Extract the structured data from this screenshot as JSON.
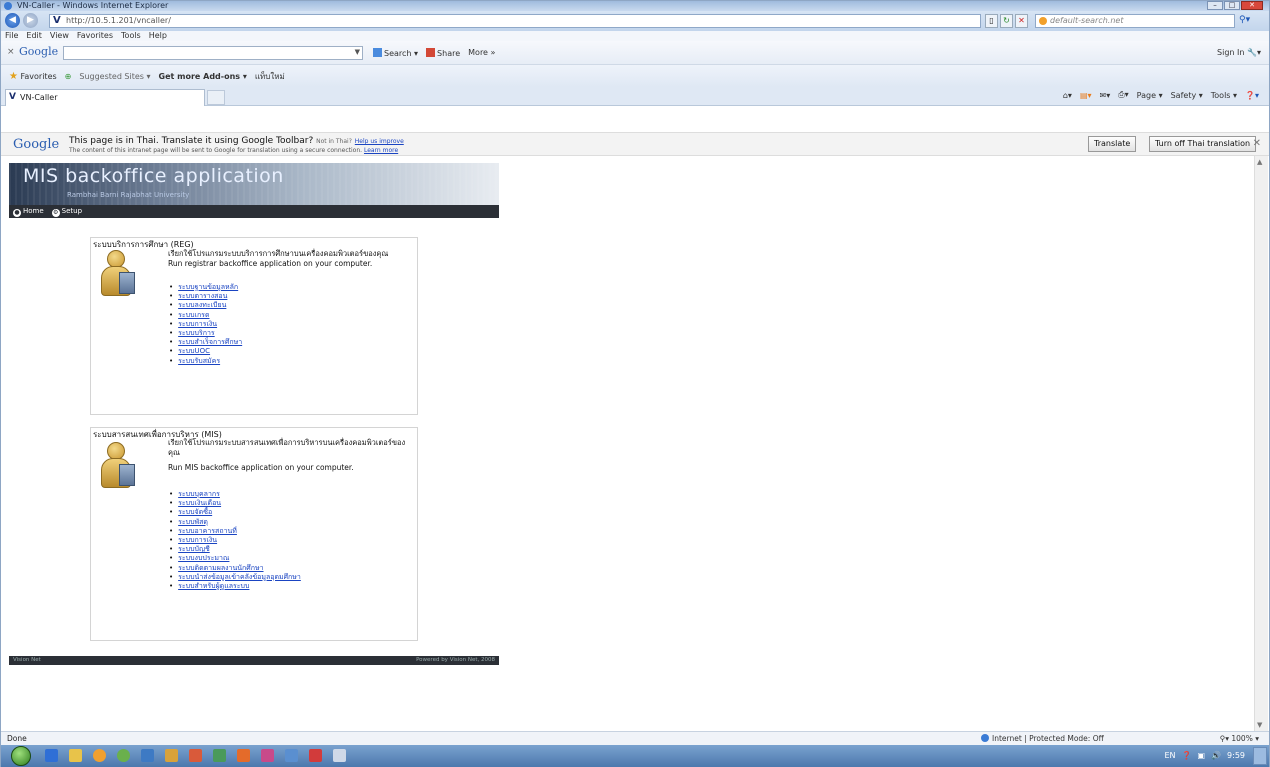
{
  "window": {
    "title": "VN-Caller - Windows Internet Explorer",
    "controls": [
      "–",
      "□",
      "✕"
    ]
  },
  "address_bar": {
    "url": "http://10.5.1.201/vncaller/",
    "search_placeholder": "default-search.net"
  },
  "menu": [
    "File",
    "Edit",
    "View",
    "Favorites",
    "Tools",
    "Help"
  ],
  "google_toolbar": {
    "logo": "Google",
    "buttons": [
      "Search",
      "Share",
      "More »"
    ],
    "sign_in": "Sign In"
  },
  "favorites_bar": {
    "favorites_label": "Favorites",
    "items": [
      "Suggested Sites ▾",
      "Get more Add-ons ▾",
      "แท็บใหม่"
    ]
  },
  "tabs": {
    "active": "VN-Caller",
    "commands": [
      "Page ▾",
      "Safety ▾",
      "Tools ▾"
    ]
  },
  "translate_bar": {
    "logo": "Google",
    "message": "This page is in Thai.  Translate it using Google Toolbar?",
    "not_in_thai": "Not in Thai?",
    "help_link": "Help us improve",
    "sub_message": "The content of this intranet page will be sent to Google for translation using a secure connection.",
    "learn_more": "Learn more",
    "translate_button": "Translate",
    "turn_off_button": "Turn off Thai translation"
  },
  "app": {
    "banner_title": "MIS backoffice application",
    "banner_subtitle": "Rambhai Barni Rajabhat University",
    "nav": [
      "Home",
      "Setup"
    ],
    "footer_left": "Vision Net",
    "footer_right": "Powered by Vision Net, 2008"
  },
  "reg_section": {
    "heading": "ระบบบริการการศึกษา (REG)",
    "desc_thai": "เรียกใช้โปรแกรมระบบบริการการศึกษาบนเครื่องคอมพิวเตอร์ของคุณ",
    "desc_en": "Run registrar backoffice application on your computer.",
    "links": [
      "ระบบฐานข้อมูลหลัก",
      "ระบบตารางสอน",
      "ระบบลงทะเบียน",
      "ระบบเกรด",
      "ระบบการเงิน",
      "ระบบบริการ",
      "ระบบสำเร็จการศึกษา",
      "ระบบUOC",
      "ระบบรับสมัคร"
    ]
  },
  "mis_section": {
    "heading": "ระบบสารสนเทศเพื่อการบริหาร (MIS)",
    "desc_thai": "เรียกใช้โปรแกรมระบบสารสนเทศเพื่อการบริหารบนเครื่องคอมพิวเตอร์ของคุณ",
    "desc_en": "Run MIS backoffice application on your computer.",
    "links": [
      "ระบบบุคลากร",
      "ระบบเงินเดือน",
      "ระบบจัดซื้อ",
      "ระบบพัสดุ",
      "ระบบอาคารสถานที่",
      "ระบบการเงิน",
      "ระบบบัญชี",
      "ระบบงบประมาณ",
      "ระบบติดตามผลงานนักศึกษา",
      "ระบบนำส่งข้อมูลเข้าคลังข้อมูลอุดมศึกษา",
      "ระบบสำหรับผู้ดูแลระบบ"
    ]
  },
  "status": {
    "left": "Done",
    "zone": "Internet | Protected Mode: Off",
    "zoom": "100%"
  },
  "taskbar": {
    "lang": "EN",
    "time": "9:59"
  }
}
